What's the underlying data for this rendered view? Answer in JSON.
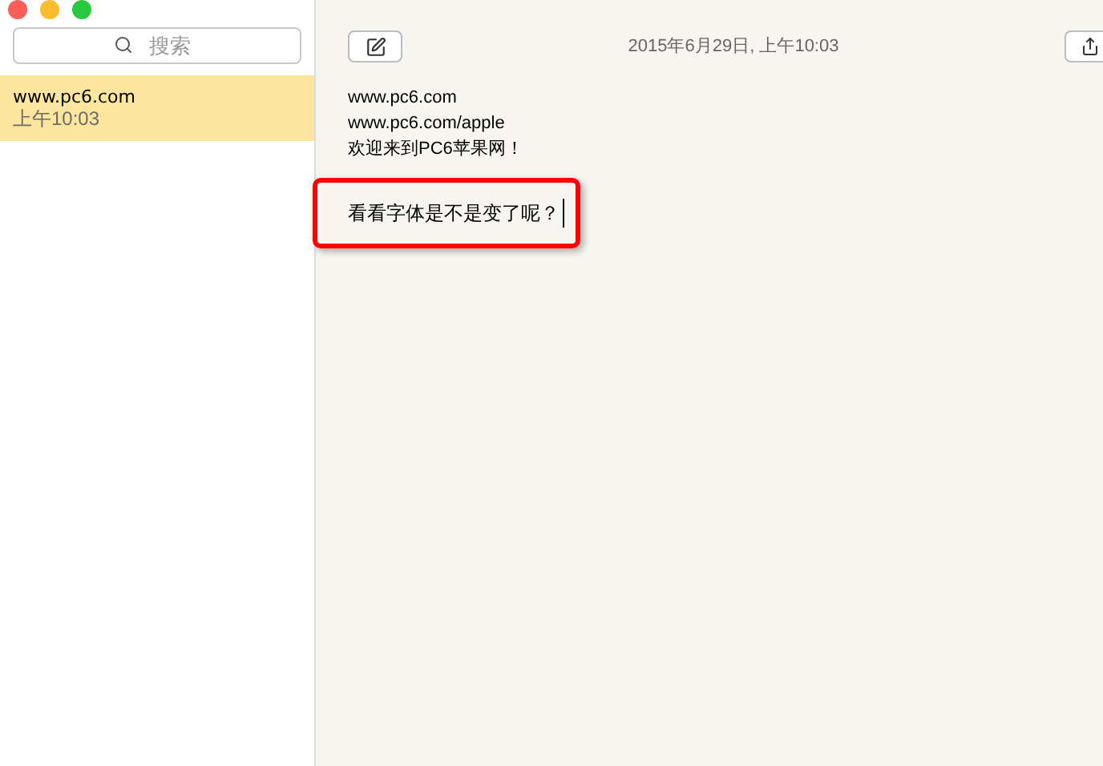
{
  "sidebar": {
    "search": {
      "placeholder": "搜索"
    },
    "notes": [
      {
        "title": "www.pc6.com",
        "time": "上午10:03",
        "selected": true
      }
    ]
  },
  "note": {
    "date": "2015年6月29日, 上午10:03",
    "lines": [
      "www.pc6.com",
      "www.pc6.com/apple",
      "欢迎来到PC6苹果网！"
    ],
    "highlighted_line": "看看字体是不是变了呢？"
  }
}
